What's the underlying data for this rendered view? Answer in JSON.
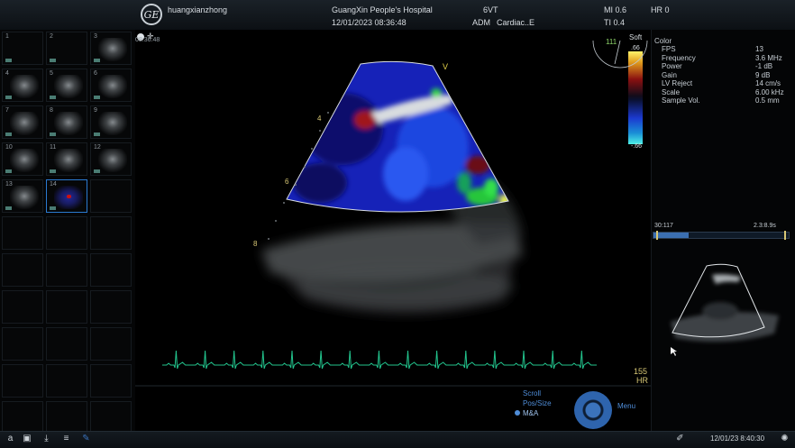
{
  "header": {
    "operator": "huangxianzhong",
    "hospital": "GuangXin People's Hospital",
    "datetime": "12/01/2023 08:36:48",
    "probe": "6VT",
    "patient_id": "ADM",
    "preset": "Cardiac..E",
    "mi": "MI 0.6",
    "ti": "TI 0.4",
    "hr": "HR 0",
    "logo_text": "GE"
  },
  "thumbnails": [
    {
      "num": "1",
      "has_image": false
    },
    {
      "num": "2",
      "has_image": false
    },
    {
      "num": "3",
      "has_image": true
    },
    {
      "num": "4",
      "has_image": true
    },
    {
      "num": "5",
      "has_image": true
    },
    {
      "num": "6",
      "has_image": true
    },
    {
      "num": "7",
      "has_image": true
    },
    {
      "num": "8",
      "has_image": true
    },
    {
      "num": "9",
      "has_image": true
    },
    {
      "num": "10",
      "has_image": true
    },
    {
      "num": "11",
      "has_image": true
    },
    {
      "num": "12",
      "has_image": true
    },
    {
      "num": "13",
      "has_image": true
    },
    {
      "num": "14",
      "has_image": true,
      "selected": true
    }
  ],
  "image_area": {
    "corner_time": "08:36:48",
    "depth_markers": [
      "4",
      "6",
      "8"
    ],
    "orientation_marker": "V",
    "color_scale_top": ".66",
    "color_scale_bottom": "-.66",
    "soft_label": "Soft",
    "angle_label": "111"
  },
  "params": {
    "title": "Color",
    "rows": [
      {
        "label": "FPS",
        "value": "13"
      },
      {
        "label": "Frequency",
        "value": "3.6 MHz"
      },
      {
        "label": "Power",
        "value": "-1 dB"
      },
      {
        "label": "Gain",
        "value": "9 dB"
      },
      {
        "label": "LV Reject",
        "value": "14 cm/s"
      },
      {
        "label": "Scale",
        "value": "6.00 kHz"
      },
      {
        "label": "Sample Vol.",
        "value": "0.5 mm"
      }
    ]
  },
  "cine": {
    "left_label": "30:117",
    "right_label": "2.3:8.9s",
    "progress": 0.26
  },
  "ecg": {
    "hr_value": "155",
    "hr_unit": "HR",
    "beat_count": 15
  },
  "controls": {
    "scroll": "Scroll",
    "pos_size": "Pos/Size",
    "ma": "M&A",
    "menu": "Menu"
  },
  "taskbar": {
    "datetime": "12/01/23 8:40:30",
    "first_icon_char": "a"
  },
  "colors": {
    "ecg": "#22c48d",
    "ui_blue": "#4f8dd8",
    "depth_marker": "#d7c775"
  }
}
